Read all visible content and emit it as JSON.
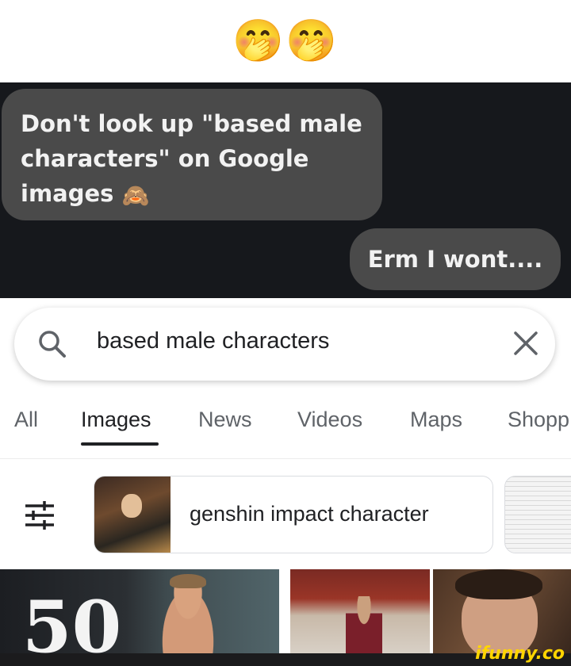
{
  "caption": {
    "emojis": "🤭🤭"
  },
  "chat": {
    "left_message_text": "Don't look up \"based male characters\" on Google images",
    "left_message_emoji": "🙈",
    "right_message": "Erm I wont...."
  },
  "search": {
    "query": "based male characters",
    "icons": {
      "search": "search-icon",
      "clear": "close-icon"
    }
  },
  "tabs": [
    "All",
    "Images",
    "News",
    "Videos",
    "Maps",
    "Shopp"
  ],
  "active_tab": "Images",
  "suggestion": {
    "label": "genshin impact character"
  },
  "image_results": {
    "first_overlay_text": "50"
  },
  "watermark": "ifunny.co",
  "colors": {
    "chat_bg": "#16181c",
    "bubble": "#4a4a4a",
    "google_text": "#202124",
    "tab_inactive": "#5f6368",
    "watermark": "#ffd500"
  }
}
